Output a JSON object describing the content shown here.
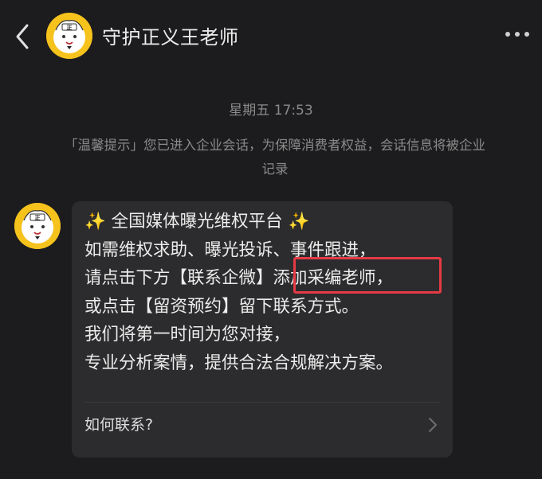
{
  "header": {
    "back_icon": "chevron-left-icon",
    "title": "守护正义王老师",
    "avatar_badge": "正",
    "more_icon": "more-dots-icon"
  },
  "chat": {
    "timestamp": "星期五 17:53",
    "notice_line1": "「温馨提示」您已进入企业会话，为保障消费者权益，会话信息将被企业",
    "notice_line2": "记录",
    "message": {
      "line1": "✨ 全国媒体曝光维权平台 ✨",
      "line2": "如需维权求助、曝光投诉、事件跟进，",
      "line3": "请点击下方【联系企微】添加采编老师，",
      "line4": "或点击【留资预约】留下联系方式。",
      "line5": "我们将第一时间为您对接，",
      "line6": "专业分析案情，提供合法合规解决方案。",
      "link_label": "如何联系?"
    }
  },
  "colors": {
    "background": "#1c1c1e",
    "bubble": "#2c2c2e",
    "avatar_yellow": "#f6c21c",
    "highlight_red": "#e53a44"
  }
}
